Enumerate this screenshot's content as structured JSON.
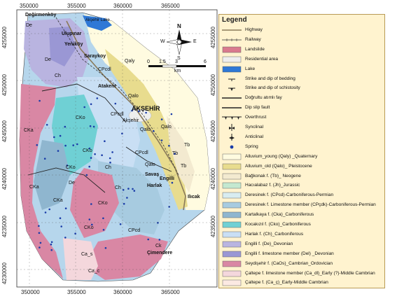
{
  "map": {
    "x_ticks": [
      "350000",
      "355000",
      "360000",
      "365000"
    ],
    "y_ticks": [
      "4255000",
      "4250000",
      "4245000",
      "4240000",
      "4235000",
      "4230000"
    ],
    "x_ticks_bottom": [
      "355000",
      "360000",
      "365000"
    ],
    "towns": [
      "Değirmenköy",
      "Ulupınar",
      "Yeniköy",
      "Saraykoy",
      "Atakent",
      "AKŞEHİR",
      "Akşehir",
      "Savaş",
      "Engilli",
      "Harlak",
      "Ilıcak",
      "Çimendere",
      "Akşehir Lake"
    ],
    "units": [
      "De",
      "De",
      "Ch",
      "CPcdl",
      "Qaly",
      "Qalo",
      "Qalo",
      "Tb",
      "Tb",
      "Qalo",
      "Tb",
      "CKo",
      "CKa",
      "CKo",
      "CKo",
      "Ch",
      "CPcdl",
      "Qalo",
      "De",
      "CPcdl",
      "Ch",
      "CKo",
      "CPcd",
      "CKo",
      "CKa",
      "Ca_s",
      "Ca_c",
      "Ck",
      "CKa"
    ],
    "north_label": "N",
    "south_label": "S",
    "east_label": "E",
    "west_label": "W",
    "scale_ticks": [
      "0",
      "1.5",
      "3",
      "6"
    ],
    "scale_unit": "km"
  },
  "legend": {
    "title": "Legend",
    "items": [
      {
        "label": "Highway",
        "symbol": "line",
        "color": "#8a7a5a"
      },
      {
        "label": "Railway",
        "symbol": "rail",
        "color": "#333333"
      },
      {
        "label": "Landslide",
        "symbol": "fill",
        "color": "#d97a8e"
      },
      {
        "label": "Residential area",
        "symbol": "fill",
        "color": "#eeeeee"
      },
      {
        "label": "Lake",
        "symbol": "fill",
        "color": "#2e78d6"
      },
      {
        "label": "Strike and dip of bedding",
        "symbol": "strike",
        "color": "#222222"
      },
      {
        "label": "Strike and dip of schistosity",
        "symbol": "schist",
        "color": "#222222"
      },
      {
        "label": "Doğrultu atımlı fay",
        "symbol": "line",
        "color": "#222222"
      },
      {
        "label": "Dip slip fault",
        "symbol": "line",
        "color": "#222222"
      },
      {
        "label": "Overthrust",
        "symbol": "thrust",
        "color": "#222222"
      },
      {
        "label": "Synclinal",
        "symbol": "syncline",
        "color": "#222222"
      },
      {
        "label": "Anticlinal",
        "symbol": "anticline",
        "color": "#222222"
      },
      {
        "label": "Spring",
        "symbol": "dot",
        "color": "#1a3ca8"
      },
      {
        "label": "Alluvium_young (Qaly) _Quaternary",
        "symbol": "fill",
        "color": "#fffbe0"
      },
      {
        "label": "Alluvium_old (Qalo)_ Pleistocene",
        "symbol": "fill",
        "color": "#e8dc8e"
      },
      {
        "label": "Bağkonak f. (Tb)_ Neogene",
        "symbol": "fill",
        "color": "#f3ead0"
      },
      {
        "label": "Hacıalabaz f. (Jh)_Jurassic",
        "symbol": "fill",
        "color": "#c4e8d0"
      },
      {
        "label": "Deresinek f. (CPcd)-Carboniferous-Permian",
        "symbol": "fill",
        "color": "#d8ecf0"
      },
      {
        "label": "Deresinek f. Limestone member (CPçdk)-Carboniferous-Permian",
        "symbol": "fill",
        "color": "#a7cbe0"
      },
      {
        "label": "Kartalkaya f. (Cka)_Carboniferous",
        "symbol": "fill",
        "color": "#8fb6cf"
      },
      {
        "label": "Kocakızıl f. (Cko)_Carboniferous",
        "symbol": "fill",
        "color": "#6fd0d4"
      },
      {
        "label": "Harlak f. (Ch)_Carboniferous",
        "symbol": "fill",
        "color": "#c9dff4"
      },
      {
        "label": "Engilli f. (De)_Devonian",
        "symbol": "fill",
        "color": "#b9b4e0"
      },
      {
        "label": "Engilli f.  limestone member (Del) _Devonian",
        "symbol": "fill",
        "color": "#9a97d4"
      },
      {
        "label": "Seydişehir f. (CaOs)_Cambrian_Ordovician",
        "symbol": "fill",
        "color": "#d987a4"
      },
      {
        "label": "Çaltepe f. limestone member (Ca_dl)_Early (?)-Middle Cambrian",
        "symbol": "fill",
        "color": "#f4d7dc"
      },
      {
        "label": "Çaltepe f. (Ca_ç)_Early-Middle Cambrian",
        "symbol": "fill",
        "color": "#fbe9e2"
      }
    ]
  }
}
